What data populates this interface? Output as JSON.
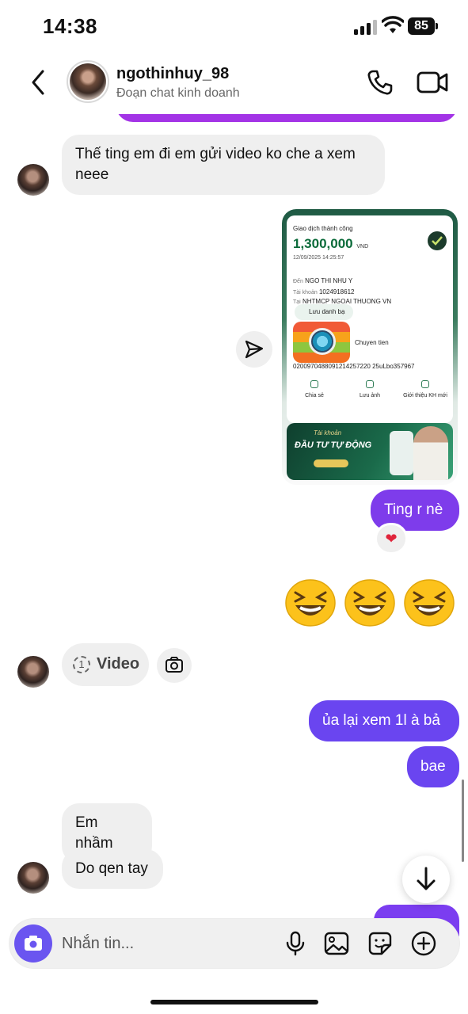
{
  "status_bar": {
    "time": "14:38",
    "battery": "85"
  },
  "header": {
    "name": "ngothinhuy_98",
    "subtitle": "Đoạn chat kinh doanh"
  },
  "messages": {
    "m1": "Thế ting em đi em gửi video ko che a xem neee",
    "m_ting": "Ting r nè",
    "reaction": "❤",
    "m_video": "Video",
    "m_video_count": "1",
    "m_ua": "ủa lại xem  1l à bả",
    "m_bae": "bae",
    "m_em_nham": "Em nhầm",
    "m_do_qen": "Do qen tay"
  },
  "receipt": {
    "label": "Giao dịch thành công",
    "amount": "1,300,000",
    "currency": "VND",
    "datetime": "12/09/2025 14:25:57",
    "to_key": "Đến",
    "to_value": "NGO THI NHU Y",
    "acct_key": "Tài khoản",
    "acct_value": "1024918612",
    "bank_key": "Tại",
    "bank_value": "NHTMCP NGOAI THUONG VN",
    "save_contact": "Lưu danh bạ",
    "note": "Chuyen tien",
    "code": "0200970488091214257220 25uLbo357967",
    "actions": [
      "Chia sẻ",
      "Lưu ảnh",
      "Giới thiệu KH mới"
    ],
    "banner_line1": "Tài khoản",
    "banner_line2": "ĐẦU TƯ TỰ ĐỘNG"
  },
  "composer": {
    "placeholder": "Nhắn tin..."
  },
  "icons": {
    "back": "chevron-left-icon",
    "call": "phone-icon",
    "video": "video-camera-icon",
    "share": "send-icon",
    "camera": "camera-icon",
    "mic": "microphone-icon",
    "gallery": "image-icon",
    "sticker": "sticker-icon",
    "add": "plus-circle-icon",
    "scroll": "arrow-down-icon"
  },
  "colors": {
    "accent": "#7b3df0",
    "incoming_bubble": "#efefef"
  }
}
